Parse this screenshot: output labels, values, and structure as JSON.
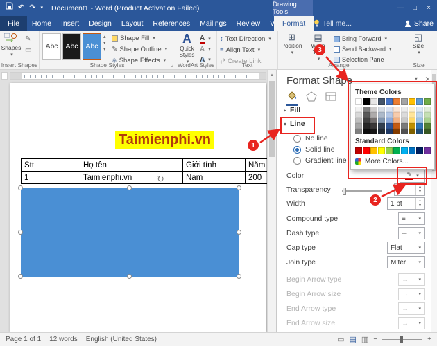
{
  "title_bar": {
    "title": "Document1 - Word (Product Activation Failed)",
    "context_header": "Drawing Tools",
    "window_buttons": {
      "minimize": "—",
      "maximize": "□",
      "close": "×"
    }
  },
  "tabs": {
    "file": "File",
    "items": [
      "Home",
      "Insert",
      "Design",
      "Layout",
      "References",
      "Mailings",
      "Review",
      "View"
    ],
    "active": "Format",
    "tell_me": "Tell me...",
    "share": "Share"
  },
  "ribbon": {
    "shapes_button": "Shapes",
    "style_preview": "Abc",
    "shape_fill": "Shape Fill",
    "shape_outline": "Shape Outline",
    "shape_effects": "Shape Effects",
    "quick_styles": "Quick Styles",
    "wordart_a": "A",
    "text_direction": "Text Direction",
    "align_text": "Align Text",
    "create_link": "Create Link",
    "position": "Position",
    "wrap_text": "Wrap Text",
    "bring_forward": "Bring Forward",
    "send_backward": "Send Backward",
    "selection_pane": "Selection Pane",
    "size": "Size",
    "group_labels": {
      "insert_shapes": "Insert Shapes",
      "shape_styles": "Shape Styles",
      "wordart_styles": "WordArt Styles",
      "text": "Text",
      "arrange": "Arrange",
      "size": "Size"
    }
  },
  "document": {
    "heading": {
      "text": "Taimienphi.vn",
      "highlight": "#ffff00",
      "color": "#b23a0c"
    },
    "table": {
      "headers": [
        "Stt",
        "Họ tên",
        "Giới tính",
        "Năm"
      ],
      "rows": [
        [
          "1",
          "Taimienphi.vn",
          "Nam",
          "200"
        ]
      ]
    },
    "shape": {
      "fill": "#4a8fd4"
    }
  },
  "pane": {
    "title": "Format Shape",
    "fill_section": "Fill",
    "line_section": "Line",
    "line_options": {
      "no_line": "No line",
      "solid_line": "Solid line",
      "gradient_line": "Gradient line",
      "selected": "Solid line"
    },
    "fields": {
      "color": "Color",
      "transparency": "Transparency",
      "width": "Width",
      "width_value": "1 pt",
      "compound": "Compound type",
      "dash": "Dash type",
      "cap": "Cap type",
      "cap_value": "Flat",
      "join": "Join type",
      "join_value": "Miter",
      "begin_arrow_type": "Begin Arrow type",
      "begin_arrow_size": "Begin Arrow size",
      "end_arrow_type": "End Arrow type",
      "end_arrow_size": "End Arrow size"
    }
  },
  "color_popup": {
    "theme_label": "Theme Colors",
    "standard_label": "Standard Colors",
    "more_colors": "More Colors...",
    "theme_base": [
      "#ffffff",
      "#000000",
      "#e7e6e6",
      "#44546a",
      "#4472c4",
      "#ed7d31",
      "#a5a5a5",
      "#ffc000",
      "#5b9bd5",
      "#70ad47"
    ],
    "theme_variants": [
      [
        "#f2f2f2",
        "#7f7f7f",
        "#d0cece",
        "#d6dce5",
        "#d9e2f3",
        "#fbe5d6",
        "#ededed",
        "#fff2cc",
        "#deebf7",
        "#e2efda"
      ],
      [
        "#d9d9d9",
        "#595959",
        "#aeabab",
        "#adb9ca",
        "#b4c7e7",
        "#f7cbac",
        "#dbdbdb",
        "#ffe599",
        "#bdd7ee",
        "#c5e0b4"
      ],
      [
        "#bfbfbf",
        "#404040",
        "#757070",
        "#8497b0",
        "#8eaadb",
        "#f4b183",
        "#c9c9c9",
        "#ffd966",
        "#9dc3e6",
        "#a9d18e"
      ],
      [
        "#a6a6a6",
        "#262626",
        "#3b3838",
        "#333f50",
        "#2f5496",
        "#c55a11",
        "#7b7b7b",
        "#bf9000",
        "#2e74b5",
        "#538135"
      ],
      [
        "#7f7f7f",
        "#0d0d0d",
        "#181717",
        "#222a35",
        "#1f3864",
        "#833c00",
        "#525252",
        "#7f6000",
        "#1f4e79",
        "#385723"
      ]
    ],
    "standard": [
      "#c00000",
      "#ff0000",
      "#ffc000",
      "#ffff00",
      "#92d050",
      "#00b050",
      "#00b0f0",
      "#0070c0",
      "#002060",
      "#7030a0"
    ]
  },
  "annotations": {
    "step1": "1",
    "step2": "2",
    "step3": "3",
    "color": "#e8241f"
  },
  "status_bar": {
    "page": "Page 1 of 1",
    "words": "12 words",
    "language": "English (United States)"
  },
  "icons": {
    "dropdown": "▾",
    "scroll_up": "▴",
    "scroll_down": "▾",
    "pencil": "✎",
    "align": "≡",
    "text_direction": "↕",
    "create_link": "⇄",
    "rotate": "↻",
    "undo": "↶",
    "redo": "↷",
    "position": "⊞",
    "wrap": "▤",
    "size": "◱",
    "effects": "◈",
    "launcher": "⌟",
    "collapse_section": "▸",
    "expand_section": "▾",
    "minus": "−",
    "plus": "+",
    "view_read": "▭",
    "view_print": "▤",
    "view_web": "▥",
    "arrow_right": "→",
    "dashes": "---",
    "close": "×",
    "textbox": "▭"
  }
}
